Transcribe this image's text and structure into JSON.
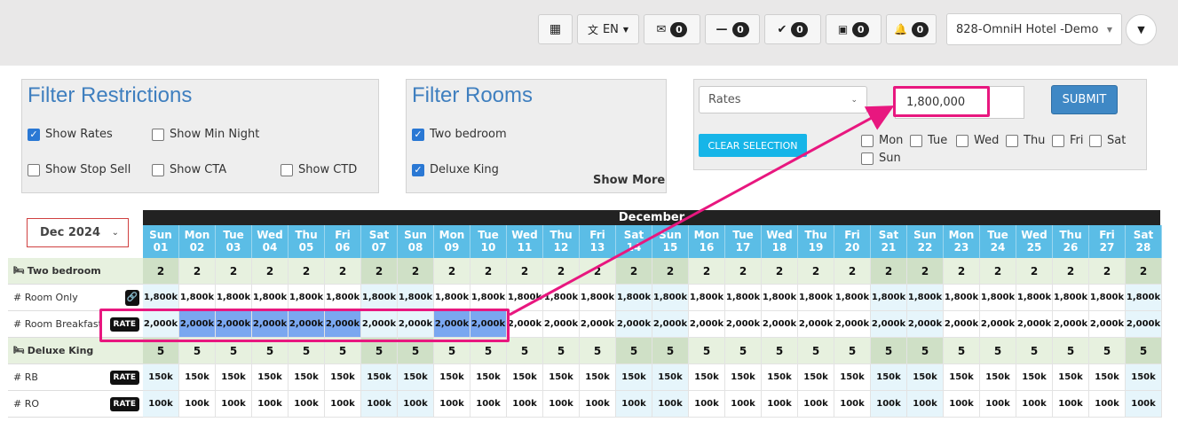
{
  "topbar": {
    "lang": "EN",
    "inbox_count": "0",
    "minus_count": "0",
    "check_count": "0",
    "calendar_count": "0",
    "bell_count": "0",
    "hotel": "828-OmniH Hotel -Demo"
  },
  "filter_restrictions": {
    "title": "Filter Restrictions",
    "show_rates": "Show Rates",
    "show_min_night": "Show Min Night",
    "show_stop_sell": "Show Stop Sell",
    "show_cta": "Show CTA",
    "show_ctd": "Show CTD"
  },
  "filter_rooms": {
    "title": "Filter Rooms",
    "two_bedroom": "Two bedroom",
    "deluxe_king": "Deluxe King",
    "show_more": "Show More"
  },
  "bulk": {
    "type": "Rates",
    "value": "1,800,000",
    "submit": "SUBMIT",
    "clear": "CLEAR SELECTION",
    "days": [
      "Mon",
      "Tue",
      "Wed",
      "Thu",
      "Fri",
      "Sat",
      "Sun"
    ]
  },
  "calendar": {
    "month_select": "Dec 2024",
    "month": "December",
    "days": [
      {
        "dow": "Sun",
        "num": "01"
      },
      {
        "dow": "Mon",
        "num": "02"
      },
      {
        "dow": "Tue",
        "num": "03"
      },
      {
        "dow": "Wed",
        "num": "04"
      },
      {
        "dow": "Thu",
        "num": "05"
      },
      {
        "dow": "Fri",
        "num": "06"
      },
      {
        "dow": "Sat",
        "num": "07"
      },
      {
        "dow": "Sun",
        "num": "08"
      },
      {
        "dow": "Mon",
        "num": "09"
      },
      {
        "dow": "Tue",
        "num": "10"
      },
      {
        "dow": "Wed",
        "num": "11"
      },
      {
        "dow": "Thu",
        "num": "12"
      },
      {
        "dow": "Fri",
        "num": "13"
      },
      {
        "dow": "Sat",
        "num": "14"
      },
      {
        "dow": "Sun",
        "num": "15"
      },
      {
        "dow": "Mon",
        "num": "16"
      },
      {
        "dow": "Tue",
        "num": "17"
      },
      {
        "dow": "Wed",
        "num": "18"
      },
      {
        "dow": "Thu",
        "num": "19"
      },
      {
        "dow": "Fri",
        "num": "20"
      },
      {
        "dow": "Sat",
        "num": "21"
      },
      {
        "dow": "Sun",
        "num": "22"
      },
      {
        "dow": "Mon",
        "num": "23"
      },
      {
        "dow": "Tue",
        "num": "24"
      },
      {
        "dow": "Wed",
        "num": "25"
      },
      {
        "dow": "Thu",
        "num": "26"
      },
      {
        "dow": "Fri",
        "num": "27"
      },
      {
        "dow": "Sat",
        "num": "28"
      }
    ],
    "rows": [
      {
        "label": "Two bedroom",
        "kind": "room",
        "value": "2"
      },
      {
        "label": "# Room Only",
        "kind": "rate",
        "value": "1,800k",
        "tag": "link"
      },
      {
        "label": "# Room Breakfast",
        "kind": "rate",
        "value": "2,000k",
        "tag": "RATE",
        "selected_until": 10
      },
      {
        "label": "Deluxe King",
        "kind": "room",
        "value": "5"
      },
      {
        "label": "# RB",
        "kind": "rate",
        "value": "150k",
        "tag": "RATE"
      },
      {
        "label": "# RO",
        "kind": "rate",
        "value": "100k",
        "tag": "RATE"
      }
    ]
  }
}
